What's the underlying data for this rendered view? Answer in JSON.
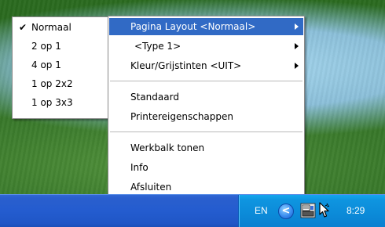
{
  "main_menu": {
    "items": [
      {
        "label": "Pagina Layout <Normaal>",
        "has_submenu": true,
        "highlighted": true
      },
      {
        "label": "<Type 1>",
        "has_submenu": true
      },
      {
        "label": "Kleur/Grijstinten <UIT>",
        "has_submenu": true
      },
      {
        "label": "Standaard",
        "has_submenu": false
      },
      {
        "label": "Printereigenschappen",
        "has_submenu": false
      },
      {
        "label": "Werkbalk tonen",
        "has_submenu": false
      },
      {
        "label": "Info",
        "has_submenu": false
      },
      {
        "label": "Afsluiten",
        "has_submenu": false
      }
    ]
  },
  "submenu": {
    "items": [
      {
        "label": "Normaal",
        "checked": true
      },
      {
        "label": "2 op 1",
        "checked": false
      },
      {
        "label": "4 op 1",
        "checked": false
      },
      {
        "label": "1 op 2x2",
        "checked": false
      },
      {
        "label": "1 op 3x3",
        "checked": false
      }
    ],
    "check_glyph": "✔"
  },
  "taskbar": {
    "language": "EN",
    "clock": "8:29",
    "chevron_glyph": "<"
  },
  "icons": {
    "tray": [
      "chevron-left-icon",
      "printer-icon",
      "pointer-cursor-icon"
    ]
  },
  "colors": {
    "highlight": "#316ac5",
    "taskbar": "#245ccf",
    "tray": "#0b8ad8"
  }
}
